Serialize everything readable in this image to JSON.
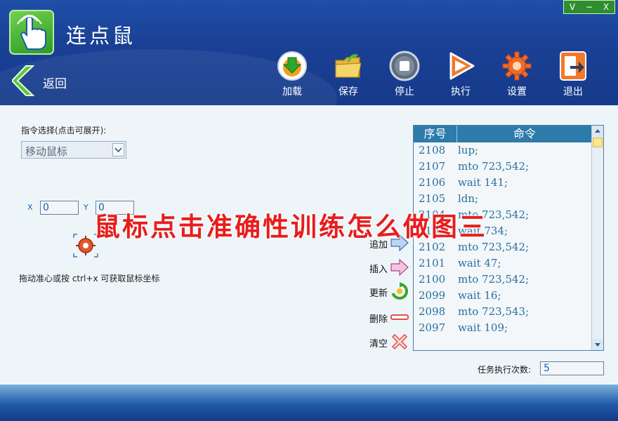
{
  "app": {
    "title": "连点鼠"
  },
  "window_controls": [
    "V",
    "−",
    "X"
  ],
  "nav": {
    "back_label": "返回"
  },
  "toolbar": {
    "load": "加载",
    "save": "保存",
    "stop": "停止",
    "run": "执行",
    "settings": "设置",
    "exit": "退出"
  },
  "command_picker": {
    "label": "指令选择(点击可展开):",
    "selected": "移动鼠标"
  },
  "coords": {
    "x_label": "X",
    "x_value": "0",
    "y_label": "Y",
    "y_value": "0"
  },
  "hint": "拖动准心或按 ctrl+x 可获取鼠标坐标",
  "actions": {
    "append": "追加",
    "insert": "插入",
    "update": "更新",
    "delete": "删除",
    "clear": "清空"
  },
  "command_list": {
    "headers": {
      "seq": "序号",
      "command": "命令"
    },
    "rows": [
      {
        "seq": "2108",
        "cmd": "lup;"
      },
      {
        "seq": "2107",
        "cmd": "mto 723,542;"
      },
      {
        "seq": "2106",
        "cmd": "wait 141;"
      },
      {
        "seq": "2105",
        "cmd": "ldn;"
      },
      {
        "seq": "2104",
        "cmd": "mto 723,542;"
      },
      {
        "seq": "2103",
        "cmd": "wait 734;"
      },
      {
        "seq": "2102",
        "cmd": "mto 723,542;"
      },
      {
        "seq": "2101",
        "cmd": "wait 47;"
      },
      {
        "seq": "2100",
        "cmd": "mto 723,542;"
      },
      {
        "seq": "2099",
        "cmd": "wait 16;"
      },
      {
        "seq": "2098",
        "cmd": "mto 723,543;"
      },
      {
        "seq": "2097",
        "cmd": "wait 109;"
      }
    ]
  },
  "task": {
    "label": "任务执行次数:",
    "value": "5"
  },
  "overlay_caption": "鼠标点击准确性训练怎么做图三",
  "colors": {
    "header_blue": "#1a4196",
    "list_header": "#2d7bab",
    "accent_green": "#2f8d2f",
    "overlay_red": "#e81d1d"
  }
}
